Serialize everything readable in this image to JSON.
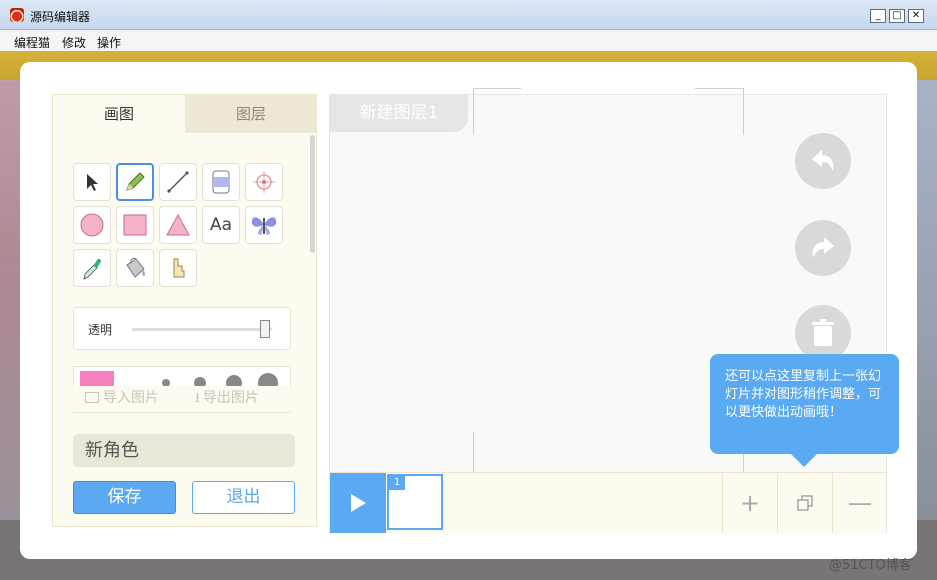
{
  "window": {
    "title": "源码编辑器",
    "btn_min": "_",
    "btn_max": "□",
    "btn_close": "✕"
  },
  "menu": [
    "编程猫",
    "修改",
    "操作"
  ],
  "panel": {
    "tabs": [
      "画图",
      "图层"
    ],
    "tools": [
      {
        "name": "select-arrow-icon"
      },
      {
        "name": "pencil-icon"
      },
      {
        "name": "line-icon"
      },
      {
        "name": "eraser-icon"
      },
      {
        "name": "crosshair-icon"
      },
      {
        "name": "circle-icon"
      },
      {
        "name": "rectangle-icon"
      },
      {
        "name": "triangle-icon"
      },
      {
        "name": "text-tool-icon",
        "label": "Aa"
      },
      {
        "name": "butterfly-icon"
      },
      {
        "name": "eyedropper-icon"
      },
      {
        "name": "paint-bucket-icon"
      },
      {
        "name": "step-shape-icon"
      }
    ],
    "opacity_label": "透明",
    "opacity_value": 0.95,
    "current_color": "#f77fbe",
    "import_image": "导入图片",
    "export_image": "导出图片",
    "character_name": "新角色",
    "save": "保存",
    "exit": "退出"
  },
  "stage": {
    "layer_name": "新建图层1",
    "actions": [
      "undo-icon",
      "redo-icon",
      "trash-icon"
    ],
    "frame_number": "1",
    "timeline_actions": {
      "add": "+",
      "remove": "—"
    }
  },
  "tooltip": {
    "text": "还可以点这里复制上一张幻灯片并对图形稍作调整，可以更快做出动画哦！"
  },
  "watermark": "@51CTO博客",
  "colors": {
    "accent": "#5ba9f2",
    "panel_bg": "#fdfaef",
    "tooltip": "#5aa9f3"
  }
}
